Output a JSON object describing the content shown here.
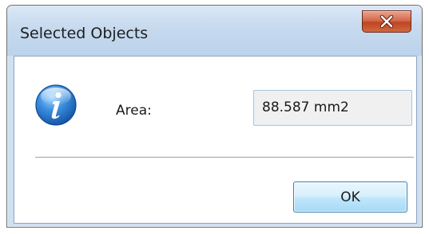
{
  "window": {
    "title": "Selected Objects",
    "close_icon": "close-icon"
  },
  "dialog": {
    "icon": "info-icon",
    "area_label": "Area:",
    "area_value": "88.587 mm2",
    "ok_label": "OK"
  },
  "colors": {
    "titlebar": "#c6d9ee",
    "close_button": "#c04423",
    "ok_button": "#bee6fd",
    "info_icon": "#2a7fd4"
  }
}
